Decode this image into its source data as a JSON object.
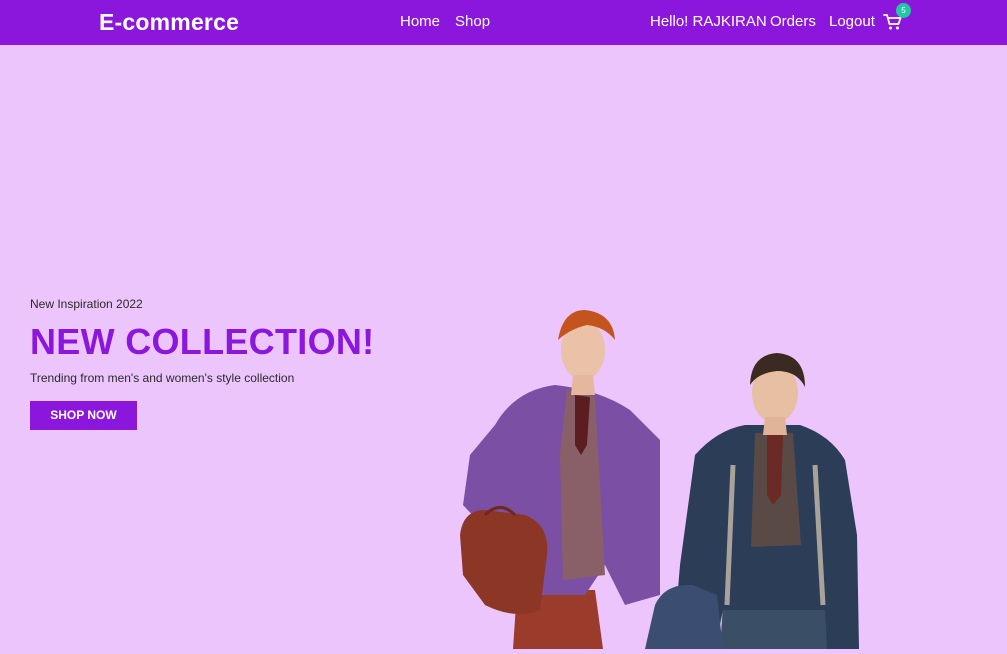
{
  "navbar": {
    "brand": "E-commerce",
    "links": {
      "home": "Home",
      "shop": "Shop",
      "greeting": "Hello! RAJKIRAN",
      "orders": "Orders",
      "logout": "Logout"
    },
    "cart_count": "5",
    "cart_icon": "shopping-cart-icon",
    "background_color": "#8c17dc",
    "badge_color": "#22c7a5"
  },
  "hero": {
    "subtitle": "New Inspiration 2022",
    "title": "NEW COLLECTION!",
    "description": "Trending from men's and women's style collection",
    "button_label": "SHOP NOW",
    "background_color": "#ecc5fd",
    "accent_color": "#8c17dc"
  }
}
